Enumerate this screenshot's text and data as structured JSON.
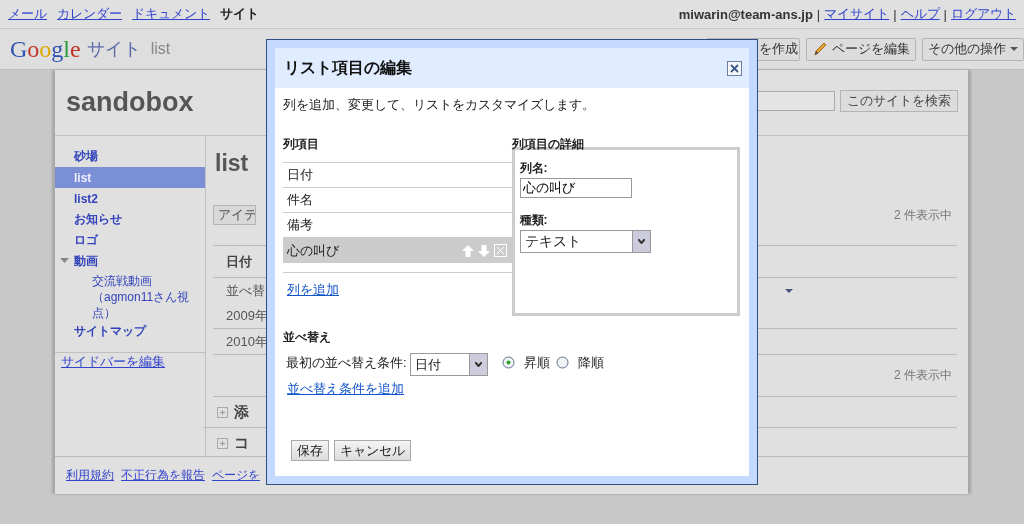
{
  "top_bar": {
    "links": [
      {
        "label": "メール",
        "kind": "link"
      },
      {
        "label": "カレンダー",
        "kind": "link"
      },
      {
        "label": "ドキュメント",
        "kind": "link"
      },
      {
        "label": "サイト",
        "kind": "current"
      }
    ],
    "email": "miwarin@team-ans.jp",
    "account_links": [
      {
        "separator": "|",
        "label": "マイサイト"
      },
      {
        "separator": "|",
        "label": "ヘルプ"
      },
      {
        "separator": "|",
        "label": "ログアウト"
      }
    ]
  },
  "header": {
    "logo": "Google",
    "product": "サイト",
    "page": "list",
    "buttons": [
      {
        "label": "を作成",
        "kind": "plain"
      },
      {
        "label": "ページを編集",
        "kind": "edit"
      },
      {
        "label": "その他の操作",
        "kind": "menu"
      }
    ]
  },
  "site": {
    "title": "sandobox",
    "search_button": "このサイトを検索"
  },
  "sidebar": {
    "items": [
      {
        "label": "砂場",
        "selected": false
      },
      {
        "label": "list",
        "selected": true
      },
      {
        "label": "list2",
        "selected": false
      },
      {
        "label": "お知らせ",
        "selected": false
      },
      {
        "label": "ロゴ",
        "selected": false
      },
      {
        "label": "動画",
        "selected": false,
        "expanded": true,
        "children": [
          {
            "label": "交流戦動画（agmon11さん視点）",
            "selected": false
          }
        ]
      },
      {
        "label": "サイトマップ",
        "selected": false
      }
    ],
    "edit_link": "サイドバーを編集"
  },
  "content": {
    "title": "list",
    "action_button": "アイテ",
    "count_top": "2 件表示中",
    "column_header": "日付",
    "rows": [
      {
        "cell": "並べ替",
        "menu": true
      },
      {
        "cell": "2009年",
        "menu": false
      },
      {
        "cell": "2010年",
        "menu": false
      }
    ],
    "count_bottom": "2 件表示中",
    "sections": [
      "添",
      "コ"
    ]
  },
  "footer": {
    "links": [
      "利用規約",
      "不正行為を報告",
      "ページを"
    ]
  },
  "dialog": {
    "title": "リスト項目の編集",
    "description": "列を追加、変更して、リストをカスタマイズします。",
    "columns_heading": "列項目",
    "columns": [
      {
        "label": "日付",
        "selected": false
      },
      {
        "label": "件名",
        "selected": false
      },
      {
        "label": "備考",
        "selected": false
      },
      {
        "label": "心の叫び",
        "selected": true
      }
    ],
    "add_column": "列を追加",
    "details_heading": "列項目の詳細",
    "name_label": "列名:",
    "name_value": "心の叫び",
    "type_label": "種類:",
    "type_value": "テキスト",
    "sort_heading": "並べ替え",
    "sort_label": "最初の並べ替え条件:",
    "sort_value": "日付",
    "order": [
      {
        "label": "昇順",
        "selected": true
      },
      {
        "label": "降順",
        "selected": false
      }
    ],
    "add_sort": "並べ替え条件を追加",
    "buttons": [
      "保存",
      "キャンセル"
    ]
  }
}
